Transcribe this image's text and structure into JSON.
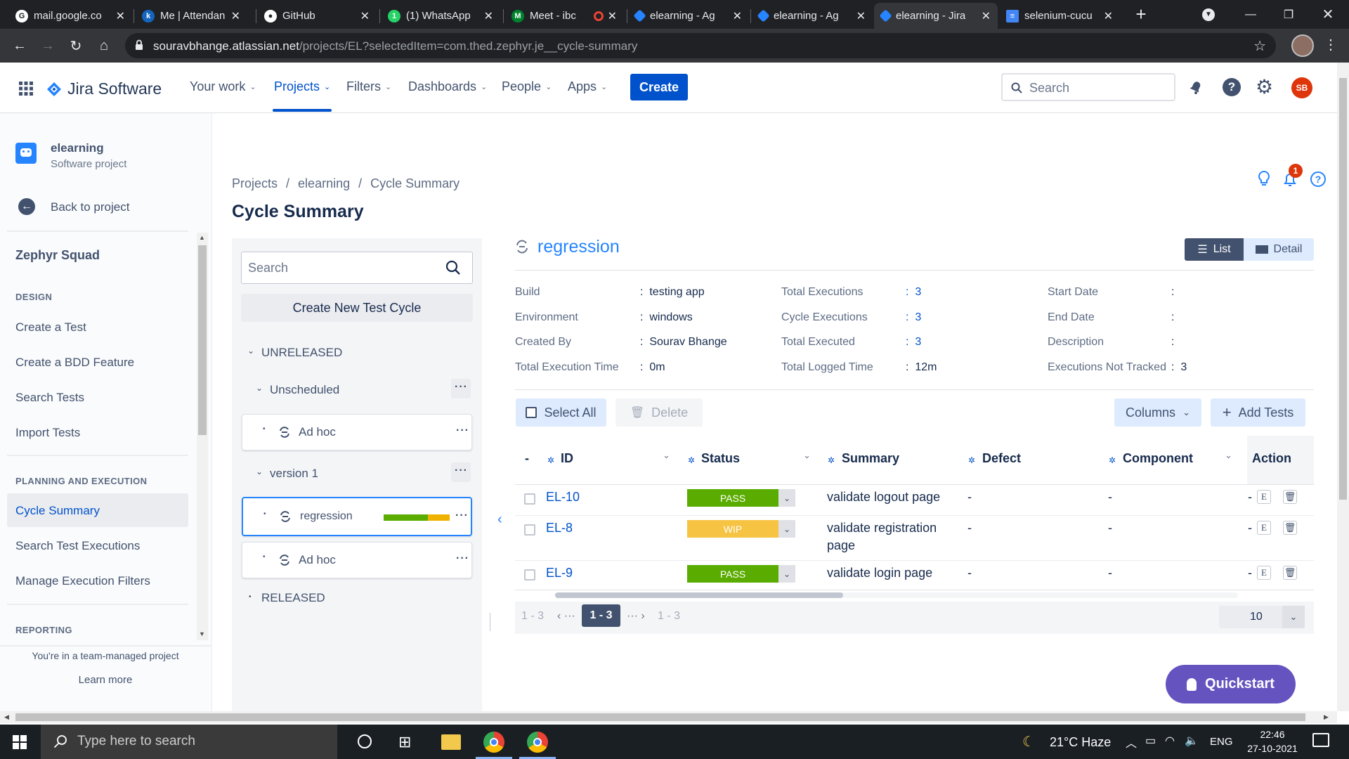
{
  "browser": {
    "tabs": [
      {
        "title": "mail.google.co",
        "icon": "google-icon"
      },
      {
        "title": "Me | Attendan",
        "icon": "k-icon"
      },
      {
        "title": "GitHub",
        "icon": "github-icon"
      },
      {
        "title": "(1) WhatsApp",
        "icon": "whatsapp-icon"
      },
      {
        "title": "Meet - ibc",
        "icon": "meet-icon"
      },
      {
        "title": "elearning - Ag",
        "icon": "jira-icon"
      },
      {
        "title": "elearning - Ag",
        "icon": "jira-icon"
      },
      {
        "title": "elearning - Jira",
        "icon": "jira-icon"
      },
      {
        "title": "selenium-cucu",
        "icon": "docs-icon"
      }
    ],
    "active_tab": 7,
    "url_host": "souravbhange.atlassian.net",
    "url_path": "/projects/EL?selectedItem=com.thed.zephyr.je__cycle-summary"
  },
  "topnav": {
    "product": "Jira Software",
    "items": [
      {
        "label": "Your work"
      },
      {
        "label": "Projects"
      },
      {
        "label": "Filters"
      },
      {
        "label": "Dashboards"
      },
      {
        "label": "People"
      },
      {
        "label": "Apps"
      }
    ],
    "create_label": "Create",
    "search_placeholder": "Search",
    "avatar_initials": "SB"
  },
  "sidebar": {
    "project_name": "elearning",
    "project_type": "Software project",
    "back_label": "Back to project",
    "section_title": "Zephyr Squad",
    "design_heading": "DESIGN",
    "design_items": [
      "Create a Test",
      "Create a BDD Feature",
      "Search Tests",
      "Import Tests"
    ],
    "planning_heading": "PLANNING AND EXECUTION",
    "planning_items": [
      "Cycle Summary",
      "Search Test Executions",
      "Manage Execution Filters"
    ],
    "reporting_heading": "REPORTING",
    "footer_text": "You're in a team-managed project",
    "learn_more": "Learn more"
  },
  "breadcrumb": {
    "items": [
      "Projects",
      "elearning",
      "Cycle Summary"
    ],
    "sep": "/"
  },
  "page_title": "Cycle Summary",
  "notifications_count": "1",
  "cycles": {
    "search_placeholder": "Search",
    "create_label": "Create New Test Cycle",
    "unreleased": "UNRELEASED",
    "unscheduled": "Unscheduled",
    "adhoc1": "Ad hoc",
    "version1": "version 1",
    "regression": "regression",
    "adhoc2": "Ad hoc",
    "released": "RELEASED",
    "regression_progress": {
      "pass_fraction": 0.667,
      "wip_fraction": 0.333,
      "pass_color": "#5aac00",
      "wip_color": "#f0b200"
    }
  },
  "detail": {
    "cycle_name": "regression",
    "view_list": "List",
    "view_detail": "Detail",
    "col1": [
      {
        "label": "Build",
        "value": "testing app"
      },
      {
        "label": "Environment",
        "value": "windows"
      },
      {
        "label": "Created By",
        "value": "Sourav Bhange"
      },
      {
        "label": "Total Execution Time",
        "value": "0m"
      }
    ],
    "col2": [
      {
        "label": "Total Executions",
        "value": "3"
      },
      {
        "label": "Cycle Executions",
        "value": "3"
      },
      {
        "label": "Total Executed",
        "value": "3"
      },
      {
        "label": "Total Logged Time",
        "value": "12m"
      }
    ],
    "col3": [
      {
        "label": "Start Date",
        "value": ""
      },
      {
        "label": "End Date",
        "value": ""
      },
      {
        "label": "Description",
        "value": ""
      },
      {
        "label": "Executions Not Tracked",
        "value": "3"
      }
    ],
    "select_all": "Select All",
    "delete": "Delete",
    "columns": "Columns",
    "add_tests": "Add Tests"
  },
  "table": {
    "headers": [
      "-",
      "ID",
      "Status",
      "Summary",
      "Defect",
      "Component",
      "Action"
    ],
    "rows": [
      {
        "id": "EL-10",
        "status": "PASS",
        "status_color": "#5aac00",
        "summary": "validate logout page",
        "summary2": "",
        "defect": "-",
        "component": "-",
        "action_dash": "-"
      },
      {
        "id": "EL-8",
        "status": "WIP",
        "status_color": "#f6c342",
        "summary": "validate registration",
        "summary2": "page",
        "defect": "-",
        "component": "-",
        "action_dash": "-"
      },
      {
        "id": "EL-9",
        "status": "PASS",
        "status_color": "#5aac00",
        "summary": "validate login page",
        "summary2": "",
        "defect": "-",
        "component": "-",
        "action_dash": "-"
      }
    ],
    "edit_glyph": "E"
  },
  "pagination": {
    "left_range": "1 - 3",
    "prev": "‹ ···",
    "current": "1 - 3",
    "next": "··· ›",
    "right_range": "1 - 3",
    "page_size": "10"
  },
  "quickstart": "Quickstart",
  "taskbar": {
    "search_placeholder": "Type here to search",
    "weather": "21°C  Haze",
    "lang": "ENG",
    "time": "22:46",
    "date": "27-10-2021"
  }
}
